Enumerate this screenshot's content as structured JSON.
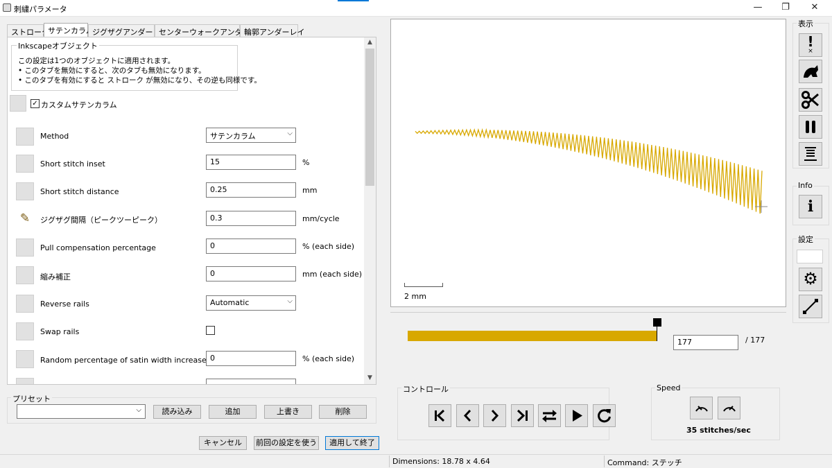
{
  "window": {
    "title": "刺繍パラメータ",
    "buttons": [
      "—",
      "❐",
      "✕"
    ]
  },
  "tabs": [
    "ストローク",
    "サテンカラム",
    "ジグザグアンダーレイ",
    "センターウォークアンダーレイ",
    "輪郭アンダーレイ"
  ],
  "active_tab": 1,
  "info_group": {
    "title": "Inkscapeオブジェクト",
    "lines": [
      "この設定は1つのオブジェクトに適用されます。",
      "• このタブを無効にすると、次のタブも無効になります。",
      "• このタブを有効にすると ストローク が無効になり、その逆も同様です。"
    ]
  },
  "custom_satin": {
    "label": "カスタムサテンカラム",
    "checked": true
  },
  "params": [
    {
      "label": "Method",
      "type": "select",
      "value": "サテンカラム",
      "unit": ""
    },
    {
      "label": "Short stitch inset",
      "type": "input",
      "value": "15",
      "unit": "%"
    },
    {
      "label": "Short stitch distance",
      "type": "input",
      "value": "0.25",
      "unit": "mm"
    },
    {
      "label": "ジグザグ間隔（ピークツーピーク）",
      "type": "input",
      "value": "0.3",
      "unit": "mm/cycle",
      "edited": true
    },
    {
      "label": "Pull compensation percentage",
      "type": "input",
      "value": "0",
      "unit": "% (each side)"
    },
    {
      "label": "縮み補正",
      "type": "input",
      "value": "0",
      "unit": "mm (each side)"
    },
    {
      "label": "Reverse rails",
      "type": "select",
      "value": "Automatic",
      "unit": ""
    },
    {
      "label": "Swap rails",
      "type": "checkbox",
      "value": "",
      "unit": ""
    },
    {
      "label": "Random percentage of satin width increase",
      "type": "input",
      "value": "0",
      "unit": "% (each side)"
    }
  ],
  "preset": {
    "title": "プリセット",
    "combo_value": "",
    "buttons": [
      "読み込み",
      "追加",
      "上書き",
      "削除"
    ]
  },
  "footer_buttons": [
    "キャンセル",
    "前回の設定を使う",
    "適用して終了"
  ],
  "preview": {
    "scale_label": "2 mm",
    "stitch_color": "#d8a800"
  },
  "slider": {
    "current": "177",
    "total": "/ 177",
    "progress": 1.0
  },
  "controls": {
    "title": "コントロール",
    "buttons": [
      "first-icon",
      "prev-icon",
      "next-icon",
      "last-icon",
      "swap-icon",
      "play-icon",
      "restart-icon"
    ]
  },
  "speed": {
    "title": "Speed",
    "value": "35 stitches/sec"
  },
  "side_toolbar": {
    "display_title": "表示",
    "info_title": "Info",
    "settings_title": "設定"
  },
  "status": {
    "dimensions": "Dimensions: 18.78 x 4.64",
    "command": "Command: ステッチ"
  }
}
